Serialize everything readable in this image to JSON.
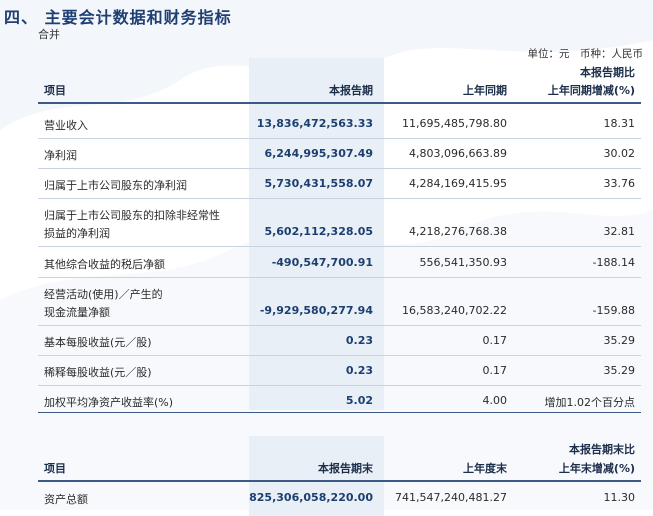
{
  "heading": {
    "title": "四、 主要会计数据和财务指标",
    "subtitle": "合并"
  },
  "unit_line": "单位：元　币种：人民币",
  "table1": {
    "headers": [
      "项目",
      "本报告期",
      "上年同期",
      "本报告期比",
      "上年同期增减(%)"
    ],
    "rows": [
      {
        "label": "营业收入",
        "current": "13,836,472,563.33",
        "prior": "11,695,485,798.80",
        "change": "18.31"
      },
      {
        "label": "净利润",
        "current": "6,244,995,307.49",
        "prior": "4,803,096,663.89",
        "change": "30.02"
      },
      {
        "label": "归属于上市公司股东的净利润",
        "current": "5,730,431,558.07",
        "prior": "4,284,169,415.95",
        "change": "33.76"
      },
      {
        "label": "归属于上市公司股东的扣除非经常性",
        "label2": "损益的净利润",
        "current": "5,602,112,328.05",
        "prior": "4,218,276,768.38",
        "change": "32.81"
      },
      {
        "label": "其他综合收益的税后净额",
        "current": "-490,547,700.91",
        "prior": "556,541,350.93",
        "change": "-188.14"
      },
      {
        "label": "经营活动(使用)／产生的",
        "label2": "现金流量净额",
        "current": "-9,929,580,277.94",
        "prior": "16,583,240,702.22",
        "change": "-159.88"
      },
      {
        "label": "基本每股收益(元／股)",
        "current": "0.23",
        "prior": "0.17",
        "change": "35.29"
      },
      {
        "label": "稀释每股收益(元／股)",
        "current": "0.23",
        "prior": "0.17",
        "change": "35.29"
      },
      {
        "label": "加权平均净资产收益率(%)",
        "current": "5.02",
        "prior": "4.00",
        "change": "增加1.02个百分点"
      }
    ]
  },
  "table2": {
    "headers": [
      "项目",
      "本报告期末",
      "上年度末",
      "本报告期末比",
      "上年末增减(%)"
    ],
    "rows": [
      {
        "label": "资产总额",
        "current": "825,306,058,220.00",
        "prior": "741,547,240,481.27",
        "change": "11.30"
      }
    ]
  }
}
